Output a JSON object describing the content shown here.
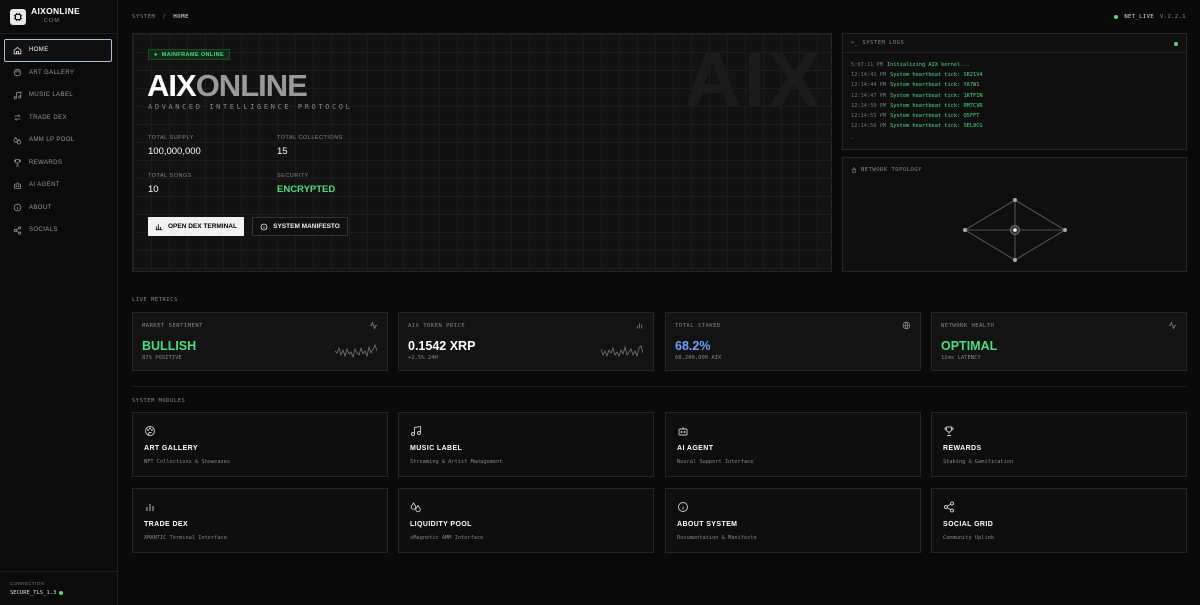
{
  "brand": {
    "name": "AIXONLINE",
    "sub": ".COM"
  },
  "sidebar": {
    "items": [
      {
        "label": "HOME",
        "icon": "home-icon",
        "active": true
      },
      {
        "label": "ART GALLERY",
        "icon": "palette-icon"
      },
      {
        "label": "MUSIC LABEL",
        "icon": "music-icon"
      },
      {
        "label": "TRADE DEX",
        "icon": "swap-icon"
      },
      {
        "label": "AMM LP POOL",
        "icon": "droplets-icon"
      },
      {
        "label": "REWARDS",
        "icon": "trophy-icon"
      },
      {
        "label": "AI AGENT",
        "icon": "bot-icon"
      },
      {
        "label": "ABOUT",
        "icon": "info-icon"
      },
      {
        "label": "SOCIALS",
        "icon": "share-icon"
      }
    ],
    "connection_label": "CONNECTION",
    "connection_value": "SECURE_TLS_1.3"
  },
  "breadcrumb": {
    "root": "SYSTEM",
    "sep": "/",
    "current": "HOME"
  },
  "status": {
    "net": "NET_LIVE",
    "version": "V.2.2.1"
  },
  "hero": {
    "badge": "MAINFRAME ONLINE",
    "title_white": "AIX",
    "title_gray": "ONLINE",
    "subtitle": "ADVANCED INTELLIGENCE PROTOCOL",
    "watermark": "AIX",
    "stats": [
      {
        "label": "TOTAL SUPPLY",
        "value": "100,000,000"
      },
      {
        "label": "TOTAL COLLECTIONS",
        "value": "15"
      },
      {
        "label": "TOTAL SONGS",
        "value": "10"
      },
      {
        "label": "SECURITY",
        "value": "ENCRYPTED"
      }
    ],
    "primary_button": "OPEN DEX TERMINAL",
    "secondary_button": "SYSTEM MANIFESTO"
  },
  "logs": {
    "title": ">_ SYSTEM LOGS",
    "lines": [
      {
        "time": "5:07:11 PM",
        "msg": "Initializing AIX kernel..."
      },
      {
        "time": "12:14:41 PM",
        "msg": "System heartbeat tick: SR21V4"
      },
      {
        "time": "12:14:44 PM",
        "msg": "System heartbeat tick: YA7W1"
      },
      {
        "time": "12:14:47 PM",
        "msg": "System heartbeat tick: 1KTFIN"
      },
      {
        "time": "12:14:50 PM",
        "msg": "System heartbeat tick: RM7CVR"
      },
      {
        "time": "12:14:53 PM",
        "msg": "System heartbeat tick: Q5FFT"
      },
      {
        "time": "12:14:56 PM",
        "msg": "System heartbeat tick: SEL9CG"
      }
    ],
    "cursor": "_"
  },
  "topology": {
    "title": "NETWORK TOPOLOGY"
  },
  "sections": {
    "metrics": "LIVE METRICS",
    "modules": "SYSTEM MODULES"
  },
  "metrics": [
    {
      "label": "MARKET SENTIMENT",
      "value": "BULLISH",
      "sub": "87% POSITIVE",
      "color": "#4ade80",
      "icon": "activity-icon"
    },
    {
      "label": "AIX TOKEN PRICE",
      "value": "0.1542 XRP",
      "sub": "+2.5% 24H",
      "color": "#ffffff",
      "icon": "bar-chart-icon"
    },
    {
      "label": "TOTAL STAKED",
      "value": "68.2%",
      "sub": "68,200,000 AIX",
      "color": "#6ea4f5",
      "icon": "globe-icon"
    },
    {
      "label": "NETWORK HEALTH",
      "value": "OPTIMAL",
      "sub": "12ms LATENCY",
      "color": "#4ade80",
      "icon": "activity-icon"
    }
  ],
  "modules": [
    {
      "title": "ART GALLERY",
      "desc": "NFT Collections & Showcases",
      "icon": "palette-icon"
    },
    {
      "title": "MUSIC LABEL",
      "desc": "Streaming & Artist Management",
      "icon": "music-icon"
    },
    {
      "title": "AI AGENT",
      "desc": "Neural Support Interface",
      "icon": "bot-icon"
    },
    {
      "title": "REWARDS",
      "desc": "Staking & Gamification",
      "icon": "trophy-icon"
    },
    {
      "title": "TRADE DEX",
      "desc": "XMANTIC Terminal Interface",
      "icon": "bar-chart-icon"
    },
    {
      "title": "LIQUIDITY POOL",
      "desc": "xMagnetic AMM Interface",
      "icon": "droplets-icon"
    },
    {
      "title": "ABOUT SYSTEM",
      "desc": "Documentation & Manifesto",
      "icon": "info-icon"
    },
    {
      "title": "SOCIAL GRID",
      "desc": "Community Uplink",
      "icon": "share-icon"
    }
  ]
}
